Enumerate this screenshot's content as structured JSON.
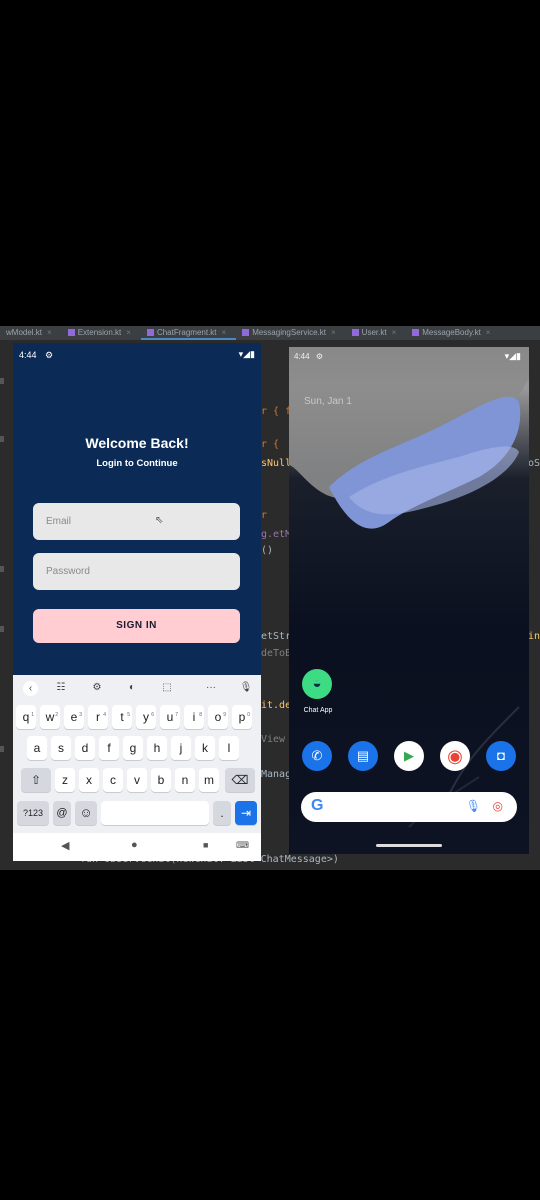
{
  "ide": {
    "tabs": [
      {
        "label": "wModel.kt"
      },
      {
        "label": "Extension.kt"
      },
      {
        "label": "ChatFragment.kt"
      },
      {
        "label": "MessagingService.kt"
      },
      {
        "label": "User.kt"
      },
      {
        "label": "MessageBody.kt"
      }
    ],
    "code_fragments": {
      "f1": "r { f",
      "f2": "r {",
      "f3": "sNull",
      "f4": "r",
      "f5": "g.etM",
      "f6": "()",
      "f7": "etStr",
      "f8": "deToB",
      "f9": "it.de",
      "f10": "View",
      "f11": "Manag",
      "f12": "fun observeChat(newChat: List<ChatMessage>)",
      "f13": "oS",
      "f14": "in"
    }
  },
  "phone1": {
    "status": {
      "time": "4:44",
      "gear": "⚙",
      "signal": "▾◢▮"
    },
    "title": "Welcome Back!",
    "subtitle": "Login to Continue",
    "email_placeholder": "Email",
    "password_placeholder": "Password",
    "signin_label": "SIGN IN",
    "keyboard": {
      "tools": [
        "‹",
        "☷",
        "⚙",
        "◐",
        "⬚",
        "···",
        "🎙"
      ],
      "row1": [
        "q",
        "w",
        "e",
        "r",
        "t",
        "y",
        "u",
        "i",
        "o",
        "p"
      ],
      "row1_hints": [
        "1",
        "2",
        "3",
        "4",
        "5",
        "6",
        "7",
        "8",
        "9",
        "0"
      ],
      "row2": [
        "a",
        "s",
        "d",
        "f",
        "g",
        "h",
        "j",
        "k",
        "l"
      ],
      "row3": [
        "z",
        "x",
        "c",
        "v",
        "b",
        "n",
        "m"
      ],
      "shift": "⇧",
      "backspace": "⌫",
      "symbols": "?123",
      "at": "@",
      "emoji": "☺",
      "period": ".",
      "enter": "⇥"
    },
    "nav": {
      "back": "◀",
      "home": "●",
      "recents": "■",
      "keyboard": "⌨"
    }
  },
  "phone2": {
    "status": {
      "time": "4:44",
      "gear": "⚙",
      "signal": "▾◢▮"
    },
    "date": "Sun, Jan 1",
    "chat_app_label": "Chat App",
    "dock": [
      {
        "name": "phone",
        "glyph": "✆",
        "color": "#1a73e8"
      },
      {
        "name": "messages",
        "glyph": "▤",
        "color": "#1a73e8"
      },
      {
        "name": "play-store",
        "glyph": "▶",
        "color": "#ffffff"
      },
      {
        "name": "chrome",
        "glyph": "◉",
        "color": "#ffffff"
      },
      {
        "name": "camera",
        "glyph": "◘",
        "color": "#1a73e8"
      }
    ],
    "search": {
      "logo": "G",
      "mic": "🎙",
      "lens": "◎"
    },
    "android_glyph": "◒"
  },
  "colors": {
    "login_bg": "#0b2b56",
    "signin_button": "#ffcdd2",
    "accent": "#1a73e8"
  }
}
